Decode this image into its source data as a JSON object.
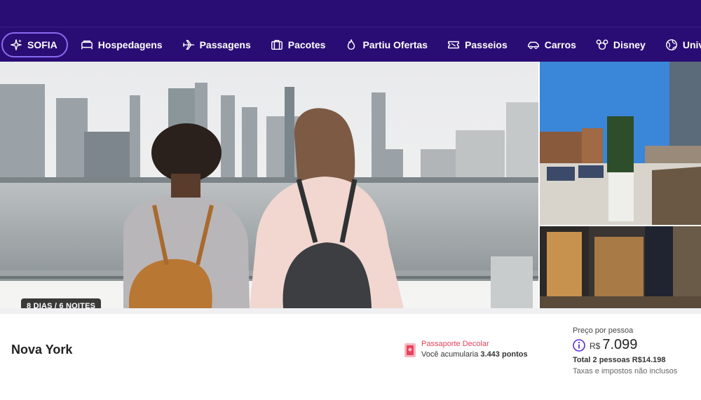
{
  "nav": {
    "items": [
      {
        "label": "SOFIA",
        "icon": "sparkles-icon"
      },
      {
        "label": "Hospedagens",
        "icon": "bed-icon"
      },
      {
        "label": "Passagens",
        "icon": "plane-icon"
      },
      {
        "label": "Pacotes",
        "icon": "suitcase-icon"
      },
      {
        "label": "Partiu Ofertas",
        "icon": "flame-icon"
      },
      {
        "label": "Passeios",
        "icon": "ticket-icon"
      },
      {
        "label": "Carros",
        "icon": "car-icon"
      },
      {
        "label": "Disney",
        "icon": "mouse-ears-icon"
      },
      {
        "label": "Universal",
        "icon": "globe-icon"
      }
    ]
  },
  "gallery": {
    "duration_badge": "8 DIAS / 6 NOITES"
  },
  "product": {
    "city": "Nova York"
  },
  "passport": {
    "title": "Passaporte Decolar",
    "text_prefix": "Você acumularia",
    "points": "3.443 pontos"
  },
  "price": {
    "label": "Preço por pessoa",
    "currency": "R$",
    "value": "7.099",
    "total": "Total 2 pessoas R$14.198",
    "taxes": "Taxas e impostos não inclusos"
  },
  "colors": {
    "brand": "#2a0d74",
    "accent": "#8a6bf0",
    "passport": "#e8435a"
  }
}
